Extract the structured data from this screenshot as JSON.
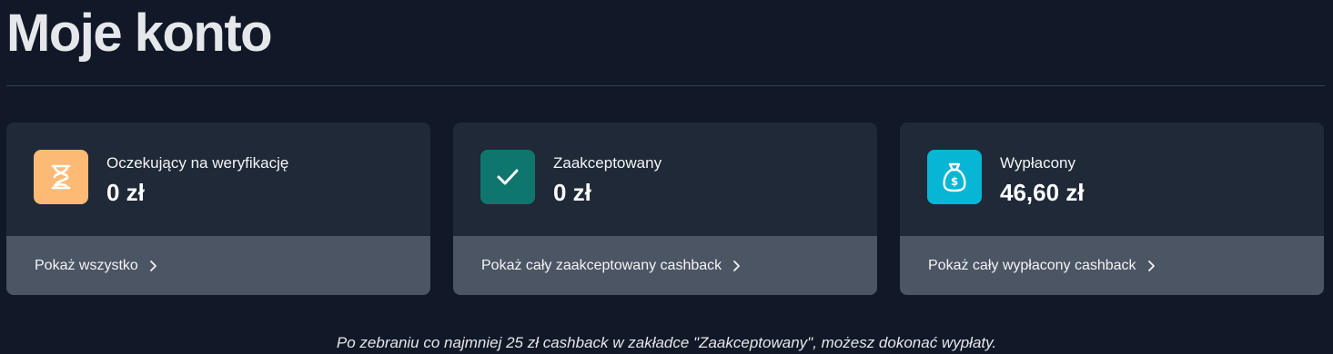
{
  "page": {
    "title": "Moje konto"
  },
  "cards": [
    {
      "label": "Oczekujący na weryfikację",
      "value": "0 zł",
      "link": "Pokaż wszystko",
      "icon": "hourglass-icon",
      "icon_color": "#fdba74"
    },
    {
      "label": "Zaakceptowany",
      "value": "0 zł",
      "link": "Pokaż cały zaakceptowany cashback",
      "icon": "check-icon",
      "icon_color": "#0f766e"
    },
    {
      "label": "Wypłacony",
      "value": "46,60 zł",
      "link": "Pokaż cały wypłacony cashback",
      "icon": "money-bag-icon",
      "icon_color": "#06b6d4"
    }
  ],
  "footnote": "Po zebraniu co najmniej 25 zł cashback w zakładce \"Zaakceptowany\", możesz dokonać wypłaty."
}
